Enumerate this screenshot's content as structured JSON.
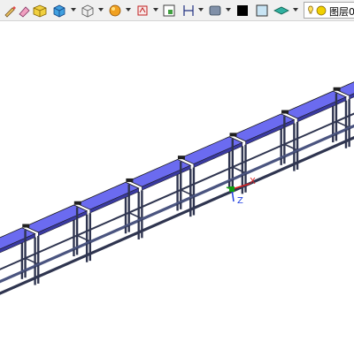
{
  "toolbar": {
    "items": [
      {
        "icon": "pencil-icon"
      },
      {
        "icon": "box-solid-icon"
      },
      {
        "icon": "cube-blue-icon"
      },
      {
        "icon": "cube-wire-icon"
      },
      {
        "icon": "material-ball-icon"
      },
      {
        "icon": "texture-icon"
      },
      {
        "icon": "frame-icon"
      },
      {
        "icon": "dimension-icon"
      },
      {
        "icon": "surface-icon"
      },
      {
        "icon": "color-black-icon"
      },
      {
        "icon": "color-lightblue-icon"
      },
      {
        "icon": "render-mode-icon"
      }
    ],
    "layer": {
      "label": "图层0("
    }
  },
  "viewport": {
    "axes": {
      "x": "X",
      "y": "Y",
      "z": "Z"
    },
    "colors": {
      "panel": "#6b6bf0",
      "panel_edge": "#1a1a1a",
      "frame": "#2f3550",
      "rail": "#4b5580",
      "axis_x": "#e02020",
      "axis_y": "#10a010",
      "axis_z": "#2040e0"
    }
  }
}
